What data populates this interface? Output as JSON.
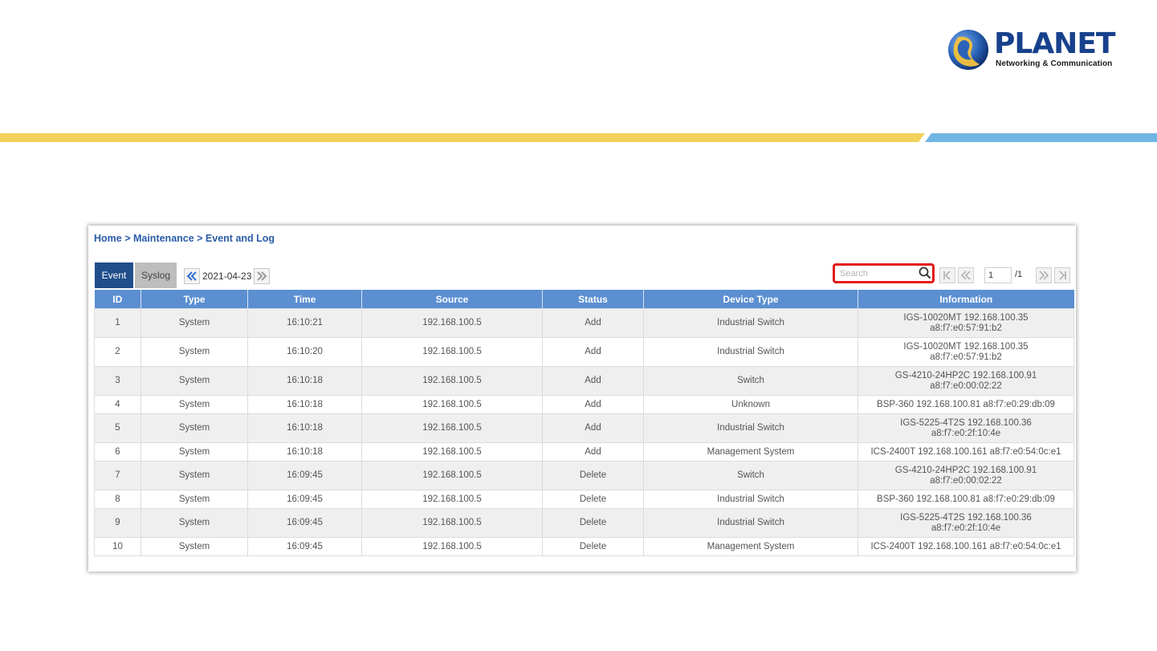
{
  "brand": {
    "name": "PLANET",
    "tagline": "Networking & Communication",
    "colors": {
      "navy": "#17418c",
      "yellow": "#f2d15a",
      "blue": "#6fb6e3"
    }
  },
  "breadcrumb": "Home > Maintenance > Event and Log",
  "tabs": [
    {
      "label": "Event",
      "active": true
    },
    {
      "label": "Syslog",
      "active": false
    }
  ],
  "date_nav": {
    "date": "2021-04-23"
  },
  "search": {
    "placeholder": "Search",
    "value": ""
  },
  "pager": {
    "page": "1",
    "total": "/1"
  },
  "table": {
    "headers": [
      "ID",
      "Type",
      "Time",
      "Source",
      "Status",
      "Device Type",
      "Information"
    ],
    "rows": [
      {
        "id": "1",
        "type": "System",
        "time": "16:10:21",
        "source": "192.168.100.5",
        "status": "Add",
        "device_type": "Industrial Switch",
        "info": [
          "IGS-10020MT 192.168.100.35",
          "a8:f7:e0:57:91:b2"
        ]
      },
      {
        "id": "2",
        "type": "System",
        "time": "16:10:20",
        "source": "192.168.100.5",
        "status": "Add",
        "device_type": "Industrial Switch",
        "info": [
          "IGS-10020MT 192.168.100.35",
          "a8:f7:e0:57:91:b2"
        ]
      },
      {
        "id": "3",
        "type": "System",
        "time": "16:10:18",
        "source": "192.168.100.5",
        "status": "Add",
        "device_type": "Switch",
        "info": [
          "GS-4210-24HP2C 192.168.100.91",
          "a8:f7:e0:00:02:22"
        ]
      },
      {
        "id": "4",
        "type": "System",
        "time": "16:10:18",
        "source": "192.168.100.5",
        "status": "Add",
        "device_type": "Unknown",
        "info": [
          "BSP-360 192.168.100.81 a8:f7:e0:29:db:09"
        ]
      },
      {
        "id": "5",
        "type": "System",
        "time": "16:10:18",
        "source": "192.168.100.5",
        "status": "Add",
        "device_type": "Industrial Switch",
        "info": [
          "IGS-5225-4T2S 192.168.100.36",
          "a8:f7:e0:2f:10:4e"
        ]
      },
      {
        "id": "6",
        "type": "System",
        "time": "16:10:18",
        "source": "192.168.100.5",
        "status": "Add",
        "device_type": "Management System",
        "info": [
          "ICS-2400T 192.168.100.161 a8:f7:e0:54:0c:e1"
        ]
      },
      {
        "id": "7",
        "type": "System",
        "time": "16:09:45",
        "source": "192.168.100.5",
        "status": "Delete",
        "device_type": "Switch",
        "info": [
          "GS-4210-24HP2C 192.168.100.91",
          "a8:f7:e0:00:02:22"
        ]
      },
      {
        "id": "8",
        "type": "System",
        "time": "16:09:45",
        "source": "192.168.100.5",
        "status": "Delete",
        "device_type": "Industrial Switch",
        "info": [
          "BSP-360 192.168.100.81 a8:f7:e0:29:db:09"
        ]
      },
      {
        "id": "9",
        "type": "System",
        "time": "16:09:45",
        "source": "192.168.100.5",
        "status": "Delete",
        "device_type": "Industrial Switch",
        "info": [
          "IGS-5225-4T2S 192.168.100.36",
          "a8:f7:e0:2f:10:4e"
        ]
      },
      {
        "id": "10",
        "type": "System",
        "time": "16:09:45",
        "source": "192.168.100.5",
        "status": "Delete",
        "device_type": "Management System",
        "info": [
          "ICS-2400T 192.168.100.161 a8:f7:e0:54:0c:e1"
        ]
      }
    ]
  }
}
